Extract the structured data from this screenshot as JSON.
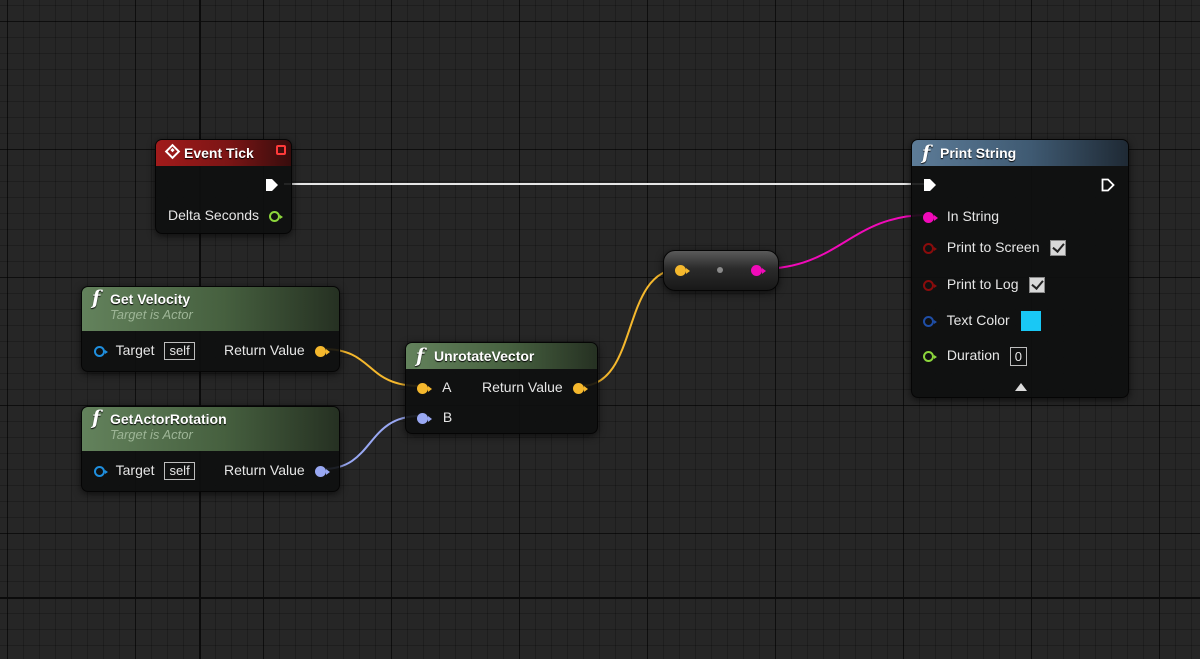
{
  "graph": {
    "nodes": {
      "event_tick": {
        "title": "Event Tick",
        "outputs": {
          "delta_seconds": "Delta Seconds"
        }
      },
      "get_velocity": {
        "title": "Get Velocity",
        "subtitle": "Target is Actor",
        "target_label": "Target",
        "target_value": "self",
        "return_label": "Return Value"
      },
      "get_actor_rotation": {
        "title": "GetActorRotation",
        "subtitle": "Target is Actor",
        "target_label": "Target",
        "target_value": "self",
        "return_label": "Return Value"
      },
      "unrotate_vector": {
        "title": "UnrotateVector",
        "input_a": "A",
        "input_b": "B",
        "return_label": "Return Value"
      },
      "print_string": {
        "title": "Print String",
        "in_string": "In String",
        "print_to_screen": "Print to Screen",
        "print_to_screen_checked": true,
        "print_to_log": "Print to Log",
        "print_to_log_checked": true,
        "text_color": "Text Color",
        "text_color_value": "#19c8f5",
        "duration": "Duration",
        "duration_value": "0"
      }
    },
    "pin_colors": {
      "exec": "#ffffff",
      "vector": "#f5b82d",
      "rotator": "#99a8f3",
      "string": "#f10ab9",
      "float": "#8cd63c",
      "object": "#1f8fde",
      "bool": "#8a0c0c",
      "linear_color": "#1f4ea6"
    },
    "header_colors": {
      "event": "#a11b1b",
      "pure_function": "#63825c",
      "function": "#5d7c98"
    }
  }
}
